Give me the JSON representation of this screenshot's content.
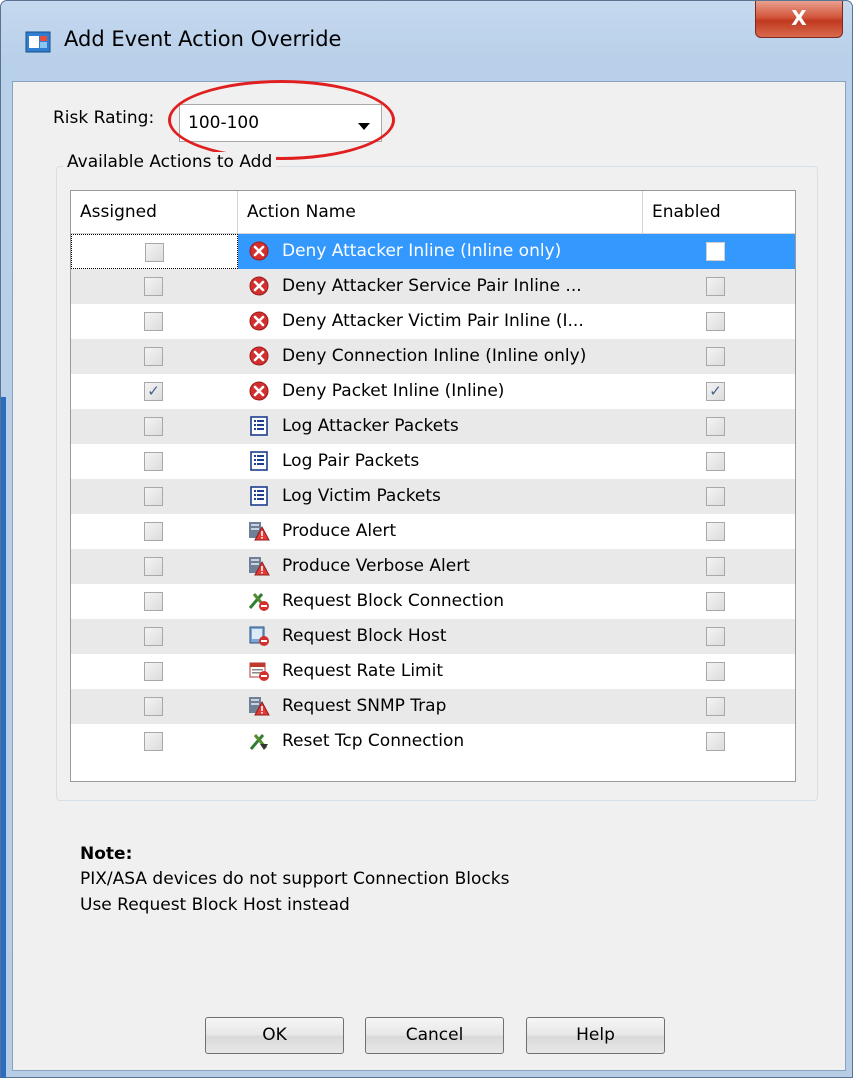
{
  "window": {
    "title": "Add Event Action Override",
    "close_label": "X"
  },
  "risk": {
    "label": "Risk Rating:",
    "value": "100-100"
  },
  "group": {
    "title": "Available Actions to Add"
  },
  "table": {
    "headers": [
      "Assigned",
      "Action Name",
      "Enabled"
    ],
    "rows": [
      {
        "assigned": false,
        "name": "Deny Attacker Inline (Inline only)",
        "icon": "deny-icon",
        "enabled": false,
        "selected": true
      },
      {
        "assigned": false,
        "name": "Deny Attacker Service Pair Inline ...",
        "icon": "deny-icon",
        "enabled": false
      },
      {
        "assigned": false,
        "name": "Deny Attacker Victim Pair Inline (I...",
        "icon": "deny-icon",
        "enabled": false
      },
      {
        "assigned": false,
        "name": "Deny Connection Inline (Inline only)",
        "icon": "deny-icon",
        "enabled": false
      },
      {
        "assigned": true,
        "name": "Deny Packet Inline (Inline)",
        "icon": "deny-icon",
        "enabled": true
      },
      {
        "assigned": false,
        "name": "Log Attacker Packets",
        "icon": "log-icon",
        "enabled": false
      },
      {
        "assigned": false,
        "name": "Log Pair Packets",
        "icon": "log-icon",
        "enabled": false
      },
      {
        "assigned": false,
        "name": "Log Victim Packets",
        "icon": "log-icon",
        "enabled": false
      },
      {
        "assigned": false,
        "name": "Produce Alert",
        "icon": "alert-icon",
        "enabled": false
      },
      {
        "assigned": false,
        "name": "Produce Verbose Alert",
        "icon": "alert-icon",
        "enabled": false
      },
      {
        "assigned": false,
        "name": "Request Block Connection",
        "icon": "block-connection-icon",
        "enabled": false
      },
      {
        "assigned": false,
        "name": "Request Block Host",
        "icon": "block-host-icon",
        "enabled": false
      },
      {
        "assigned": false,
        "name": "Request Rate Limit",
        "icon": "rate-limit-icon",
        "enabled": false
      },
      {
        "assigned": false,
        "name": "Request SNMP Trap",
        "icon": "alert-icon",
        "enabled": false
      },
      {
        "assigned": false,
        "name": "Reset Tcp Connection",
        "icon": "reset-connection-icon",
        "enabled": false
      }
    ]
  },
  "note": {
    "title": "Note:",
    "line1": "PIX/ASA devices do not support Connection Blocks",
    "line2": "Use Request Block Host instead"
  },
  "buttons": {
    "ok": "OK",
    "cancel": "Cancel",
    "help": "Help"
  },
  "colors": {
    "selection": "#3399ff",
    "highlight_oval": "#e02020",
    "deny_red": "#d32f2f"
  }
}
